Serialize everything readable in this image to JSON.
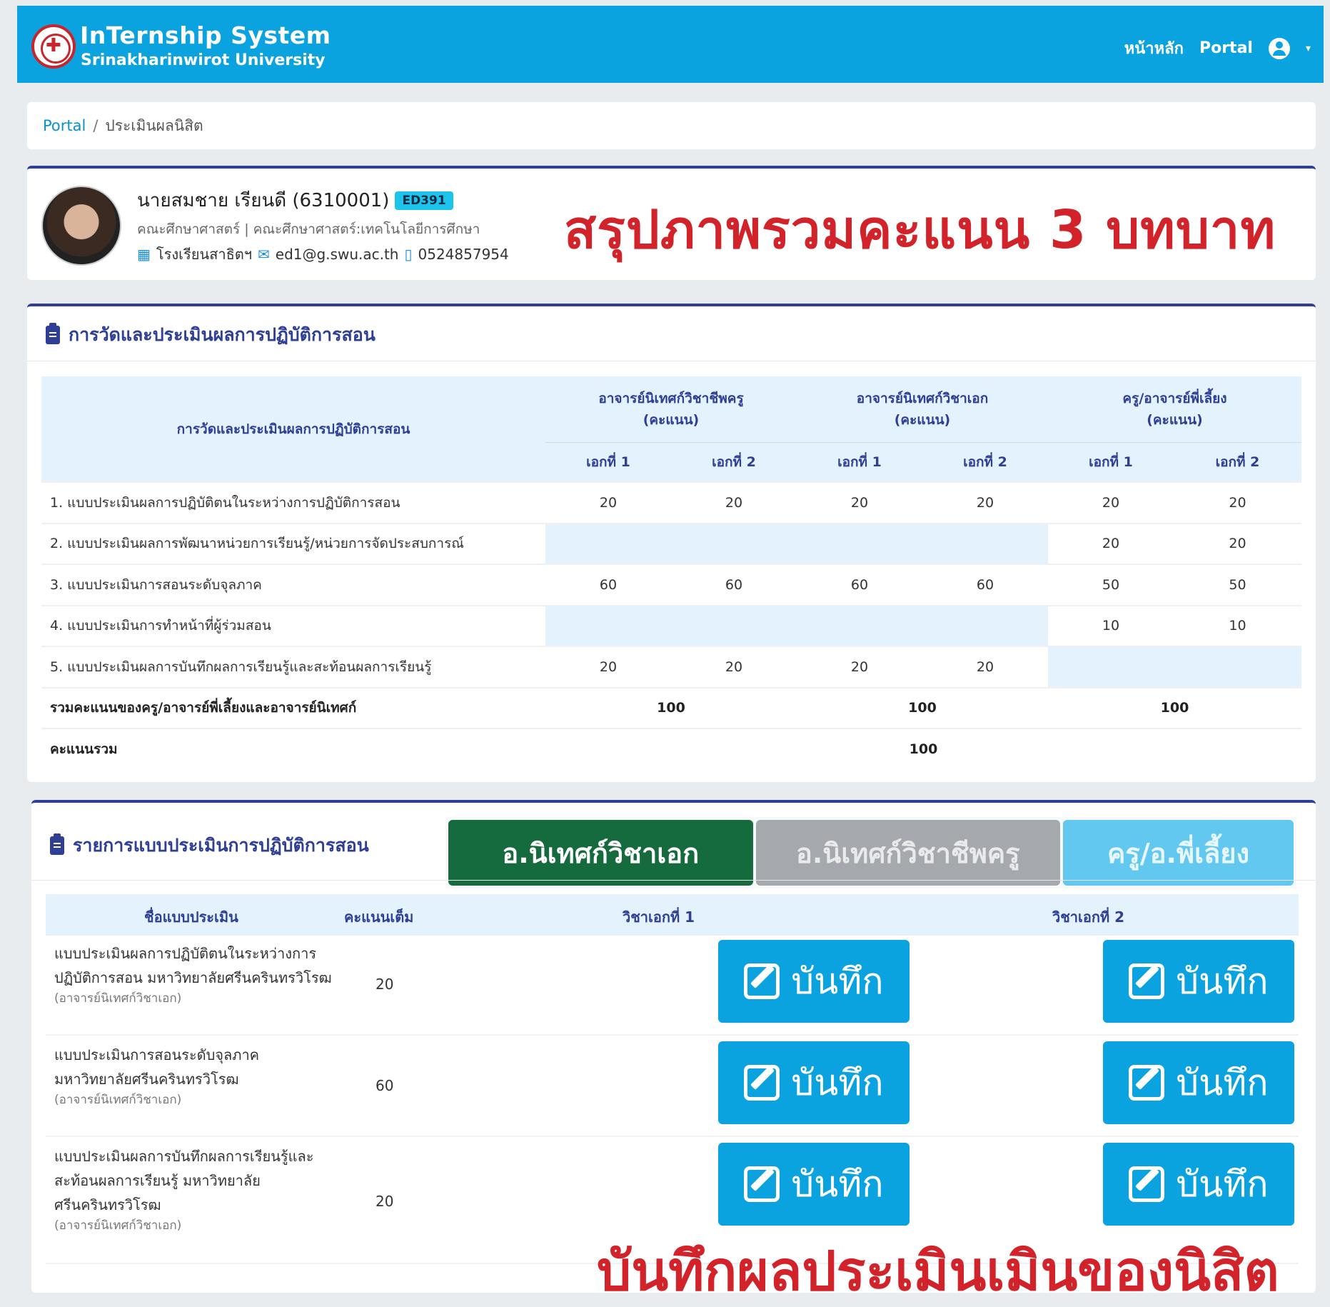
{
  "navbar": {
    "title": "InTernship System",
    "subtitle": "Srinakharinwirot University",
    "link_home": "หน้าหลัก",
    "link_portal": "Portal",
    "caret": "▾",
    "bg_color": "#0aa3df"
  },
  "breadcrumb": {
    "root": "Portal",
    "sep": "/",
    "current": "ประเมินผลนิสิต"
  },
  "student": {
    "name": "นายสมชาย เรียนดี (6310001)",
    "course_badge": "ED391",
    "faculty": "คณะศึกษาศาสตร์ | คณะศึกษาศาสตร์:เทคโนโลยีการศึกษา",
    "school": "โรงเรียนสาธิตฯ",
    "email": "ed1@g.swu.ac.th",
    "phone": "0524857954"
  },
  "overlay": {
    "top": "สรุปภาพรวมคะแนน 3 บทบาท",
    "bottom": "บันทึกผลประเมินเมินของนิสิต",
    "color": "#d2232a"
  },
  "eval_section": {
    "heading": "การวัดและประเมินผลการปฏิบัติการสอน",
    "col_main": "การวัดและประเมินผลการปฏิบัติการสอน",
    "groups": [
      {
        "line1": "อาจารย์นิเทศก์วิชาชีพครู",
        "line2": "(คะแนน)"
      },
      {
        "line1": "อาจารย์นิเทศก์วิชาเอก",
        "line2": "(คะแนน)"
      },
      {
        "line1": "ครู/อาจารย์พี่เลี้ยง",
        "line2": "(คะแนน)"
      }
    ],
    "sub_cols": [
      "เอกที่ 1",
      "เอกที่ 2",
      "เอกที่ 1",
      "เอกที่ 2",
      "เอกที่ 1",
      "เอกที่ 2"
    ],
    "rows": [
      {
        "label": "1. แบบประเมินผลการปฏิบัติตนในระหว่างการปฏิบัติการสอน",
        "values": [
          "20",
          "20",
          "20",
          "20",
          "20",
          "20"
        ]
      },
      {
        "label": "2. แบบประเมินผลการพัฒนาหน่วยการเรียนรู้/หน่วยการจัดประสบการณ์",
        "values": [
          "",
          "",
          "",
          "",
          "20",
          "20"
        ]
      },
      {
        "label": "3. แบบประเมินการสอนระดับจุลภาค",
        "values": [
          "60",
          "60",
          "60",
          "60",
          "50",
          "50"
        ]
      },
      {
        "label": "4. แบบประเมินการทำหน้าที่ผู้ร่วมสอน",
        "values": [
          "",
          "",
          "",
          "",
          "10",
          "10"
        ]
      },
      {
        "label": "5. แบบประเมินผลการบันทึกผลการเรียนรู้และสะท้อนผลการเรียนรู้",
        "values": [
          "20",
          "20",
          "20",
          "20",
          "",
          ""
        ]
      }
    ],
    "subtotal_label": "รวมคะแนนของครู/อาจารย์พี่เลี้ยงและอาจารย์นิเทศก์",
    "subtotals": [
      "100",
      "100",
      "100"
    ],
    "total_label": "คะแนนรวม",
    "total": "100"
  },
  "list_section": {
    "heading": "รายการแบบประเมินการปฏิบัติการสอน",
    "tabs": [
      "อ.นิเทศก์วิชาเอก",
      "อ.นิเทศก์วิชาชีพครู",
      "ครู/อ.พี่เลี้ยง"
    ],
    "columns": [
      "ชื่อแบบประเมิน",
      "คะแนนเต็ม",
      "วิชาเอกที่ 1",
      "วิชาเอกที่ 2"
    ],
    "save_label": "บันทึก",
    "items": [
      {
        "line1": "แบบประเมินผลการปฏิบัติตนในระหว่างการ",
        "line2": "ปฏิบัติการสอน มหาวิทยาลัยศรีนครินทรวิโรฒ",
        "line3": "",
        "role": "(อาจารย์นิเทศก์วิชาเอก)",
        "score": "20"
      },
      {
        "line1": "แบบประเมินการสอนระดับจุลภาค",
        "line2": "มหาวิทยาลัยศรีนครินทรวิโรฒ",
        "line3": "",
        "role": "(อาจารย์นิเทศก์วิชาเอก)",
        "score": "60"
      },
      {
        "line1": "แบบประเมินผลการบันทึกผลการเรียนรู้และ",
        "line2": "สะท้อนผลการเรียนรู้ มหาวิทยาลัย",
        "line3": "ศรีนครินทรวิโรฒ",
        "role": "(อาจารย์นิเทศก์วิชาเอก)",
        "score": "20"
      }
    ]
  }
}
